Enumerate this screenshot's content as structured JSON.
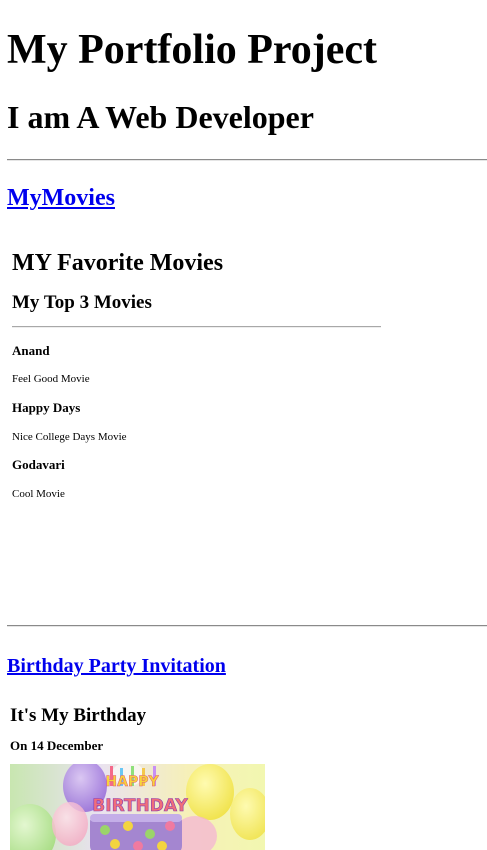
{
  "header": {
    "title": "My Portfolio Project",
    "subtitle": "I am A Web Developer"
  },
  "links": {
    "movies": "MyMovies",
    "birthday": "Birthday Party Invitation"
  },
  "movies": {
    "heading": "MY Favorite Movies",
    "subheading": "My Top 3 Movies",
    "items": [
      {
        "name": "Anand",
        "description": "Feel Good Movie"
      },
      {
        "name": "Happy Days",
        "description": "Nice College Days Movie"
      },
      {
        "name": "Godavari",
        "description": "Cool Movie"
      }
    ]
  },
  "birthday": {
    "heading": "It's My Birthday",
    "date": "On 14 December",
    "image_text_top": "HAPPY",
    "image_text_bottom": "BIRTHDAY"
  }
}
